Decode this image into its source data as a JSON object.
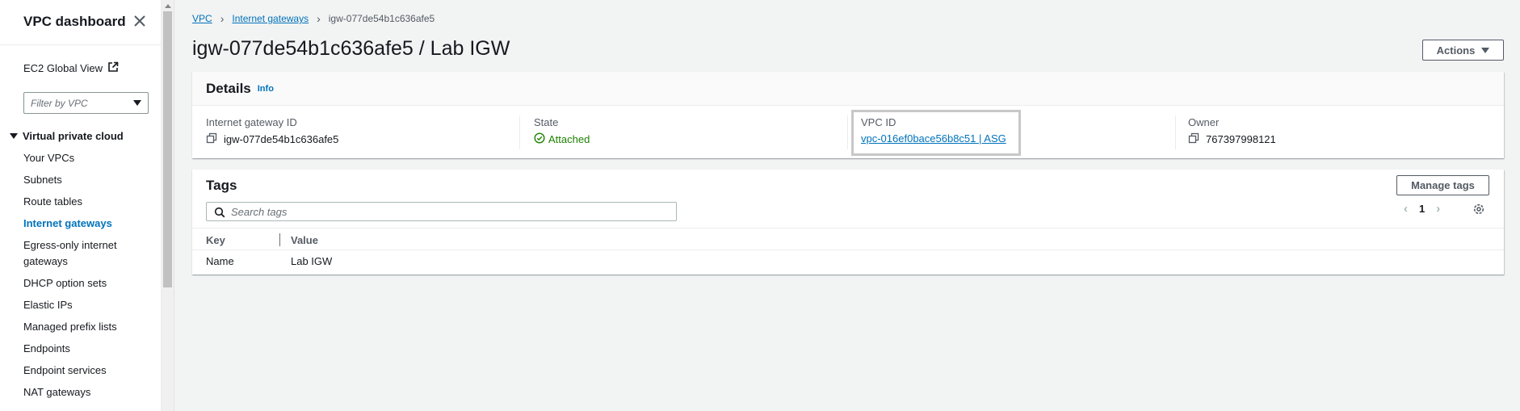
{
  "sidebar": {
    "title": "VPC dashboard",
    "global_view": "EC2 Global View",
    "filter_placeholder": "Filter by VPC",
    "section": "Virtual private cloud",
    "items": [
      {
        "label": "Your VPCs"
      },
      {
        "label": "Subnets"
      },
      {
        "label": "Route tables"
      },
      {
        "label": "Internet gateways",
        "active": true
      },
      {
        "label": "Egress-only internet gateways"
      },
      {
        "label": "DHCP option sets"
      },
      {
        "label": "Elastic IPs"
      },
      {
        "label": "Managed prefix lists"
      },
      {
        "label": "Endpoints"
      },
      {
        "label": "Endpoint services"
      },
      {
        "label": "NAT gateways"
      }
    ]
  },
  "breadcrumb": {
    "root": "VPC",
    "parent": "Internet gateways",
    "current": "igw-077de54b1c636afe5"
  },
  "page": {
    "title": "igw-077de54b1c636afe5 / Lab IGW",
    "actions_label": "Actions"
  },
  "details": {
    "title": "Details",
    "info": "Info",
    "igw_label": "Internet gateway ID",
    "igw_value": "igw-077de54b1c636afe5",
    "state_label": "State",
    "state_value": "Attached",
    "vpc_label": "VPC ID",
    "vpc_value": "vpc-016ef0bace56b8c51 | ASG",
    "owner_label": "Owner",
    "owner_value": "767397998121"
  },
  "tags": {
    "title": "Tags",
    "manage_label": "Manage tags",
    "search_placeholder": "Search tags",
    "page": "1",
    "columns": {
      "key": "Key",
      "value": "Value"
    },
    "rows": [
      {
        "key": "Name",
        "value": "Lab IGW"
      }
    ]
  },
  "colors": {
    "link": "#0073bb",
    "success": "#1d8102",
    "text": "#16191f",
    "secondary": "#545b64"
  }
}
